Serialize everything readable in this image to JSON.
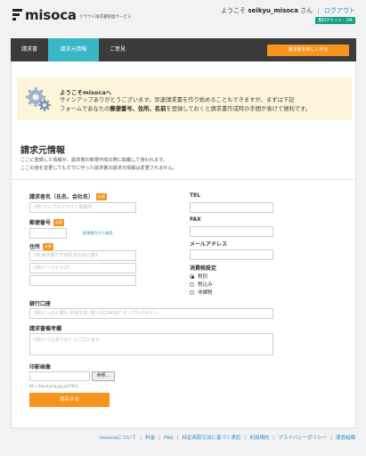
{
  "header": {
    "logo_text": "misoca",
    "logo_sub": "クラウド請求書管理サービス",
    "greeting_prefix": "ようこそ",
    "username": "seikyu_misoca",
    "greeting_suffix": "さん",
    "separator": "|",
    "logout": "ログアウト",
    "badge": "無料チケット：3件"
  },
  "nav": {
    "tabs": [
      {
        "label": "請求書"
      },
      {
        "label": "請求元情報"
      },
      {
        "label": "ご意見"
      }
    ],
    "cta": "請求書を新しく作る"
  },
  "welcome": {
    "title": "ようこそmisocaへ",
    "line1": "サインアップありがとうございます。早速請求書を作り始めることもできますが、まずは下記",
    "line2_a": "フォームであなたの",
    "line2_b": "郵便番号、住所、名前",
    "line2_c": "を登録しておくと請求書作成時の手間が省けて便利です。"
  },
  "section": {
    "title": "請求元情報",
    "desc1": "ここに登録した情報が、請求書の新規作成の際に転載して使われます。",
    "desc2": "ここの値を変更してもすでに作った請求書の請求元情報は変更されません。"
  },
  "form": {
    "required_badge": "必須",
    "name_label": "請求者名（氏名、会社名）",
    "name_placeholder": "(例) サンプルデザイン事務所",
    "zip_label": "郵便番号",
    "zip_value": "",
    "zip_link": "郵便番号から検索",
    "address_label": "住所",
    "address1_placeholder": "(例)東京都千代田区日比谷公園1",
    "address2_placeholder": "(例)パークビル1F",
    "address3_placeholder": "",
    "tel_label": "TEL",
    "tel_value": "",
    "fax_label": "FAX",
    "fax_value": "",
    "email_label": "メールアドレス",
    "email_value": "",
    "tax_label": "消費税設定",
    "tax_options": [
      {
        "label": "税別",
        "selected": true
      },
      {
        "label": "税込み",
        "selected": false
      },
      {
        "label": "非課税",
        "selected": false
      }
    ],
    "bank_label": "銀行口座",
    "bank_placeholder": "(例)にっぽん銀行 中央支店 (普) 01234567 サンプルデザイン",
    "note_label": "請求書備考欄",
    "note_placeholder": "(例)いつもありがとうございます。",
    "stamp_label": "印影画像",
    "stamp_file_value": "",
    "browse_label": "参照...",
    "stamp_hint": "80 x 80px(jpeg,jpg,gif,PNG)",
    "save_label": "保存する"
  },
  "footer": {
    "links": [
      {
        "label": "misocaについて"
      },
      {
        "label": "料金"
      },
      {
        "label": "FAQ"
      },
      {
        "label": "特定商取引法に基づく表記"
      },
      {
        "label": "利用規約"
      },
      {
        "label": "プライバシーポリシー"
      },
      {
        "label": "運営組織"
      }
    ],
    "separator": "|"
  },
  "colors": {
    "accent_orange": "#f7941d",
    "nav_active": "#38b7c7",
    "nav_bg": "#3b3b3b",
    "link_blue": "#2a8fcf",
    "welcome_bg": "#fdf5d9",
    "badge_green": "#16a085"
  }
}
